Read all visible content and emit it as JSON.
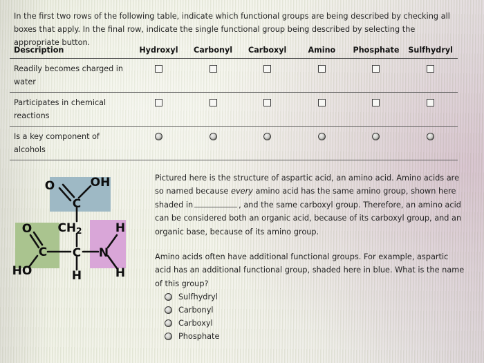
{
  "instructions": {
    "line1": "In the first two rows of the following table, indicate which functional groups are being described by checking all boxes",
    "line2": "that apply. In the final row, indicate the single functional group being described by selecting the appropriate button."
  },
  "table": {
    "columns": [
      "Description",
      "Hydroxyl",
      "Carbonyl",
      "Carboxyl",
      "Amino",
      "Phosphate",
      "Sulfhydryl"
    ],
    "rows": [
      {
        "description": "Readily becomes charged in water",
        "control": "checkbox"
      },
      {
        "description": "Participates in chemical reactions",
        "control": "checkbox"
      },
      {
        "description": "Is a key component of alcohols",
        "control": "radio"
      }
    ]
  },
  "figure": {
    "title": "aspartic-acid-structure",
    "atoms": {
      "carboxyl_top_O": "O",
      "carboxyl_top_OH": "OH",
      "carboxyl_top_C": "C",
      "methylene": "CH",
      "methylene_sub": "2",
      "carboxyl_side_O": "O",
      "carboxyl_side_HO": "HO",
      "carboxyl_side_C": "C",
      "alpha_C": "C",
      "alpha_H": "H",
      "amino_N": "N",
      "amino_H1": "H",
      "amino_H2": "H"
    },
    "shading": {
      "blue_group_color": "#9eb9c5",
      "green_group_color": "#aac48f",
      "pink_group_color": "#d9a6d8"
    }
  },
  "passage": {
    "p1_a": "Pictured here is the structure of aspartic acid, an amino acid. Amino acids are so named because ",
    "p1_em": "every",
    "p1_b": " amino acid has the same amino group, shown here shaded in",
    "p1_c": ", and the same carboxyl group. Therefore, an amino acid can be considered both an organic acid, because of its carboxyl group, and an organic base, because of its amino group.",
    "p2": "Amino acids often have additional functional groups. For example, aspartic acid has an additional functional group, shaded here in blue. What is the name of this group?"
  },
  "answers": {
    "options": [
      "Sulfhydryl",
      "Carbonyl",
      "Carboxyl",
      "Phosphate"
    ],
    "selected": null
  }
}
